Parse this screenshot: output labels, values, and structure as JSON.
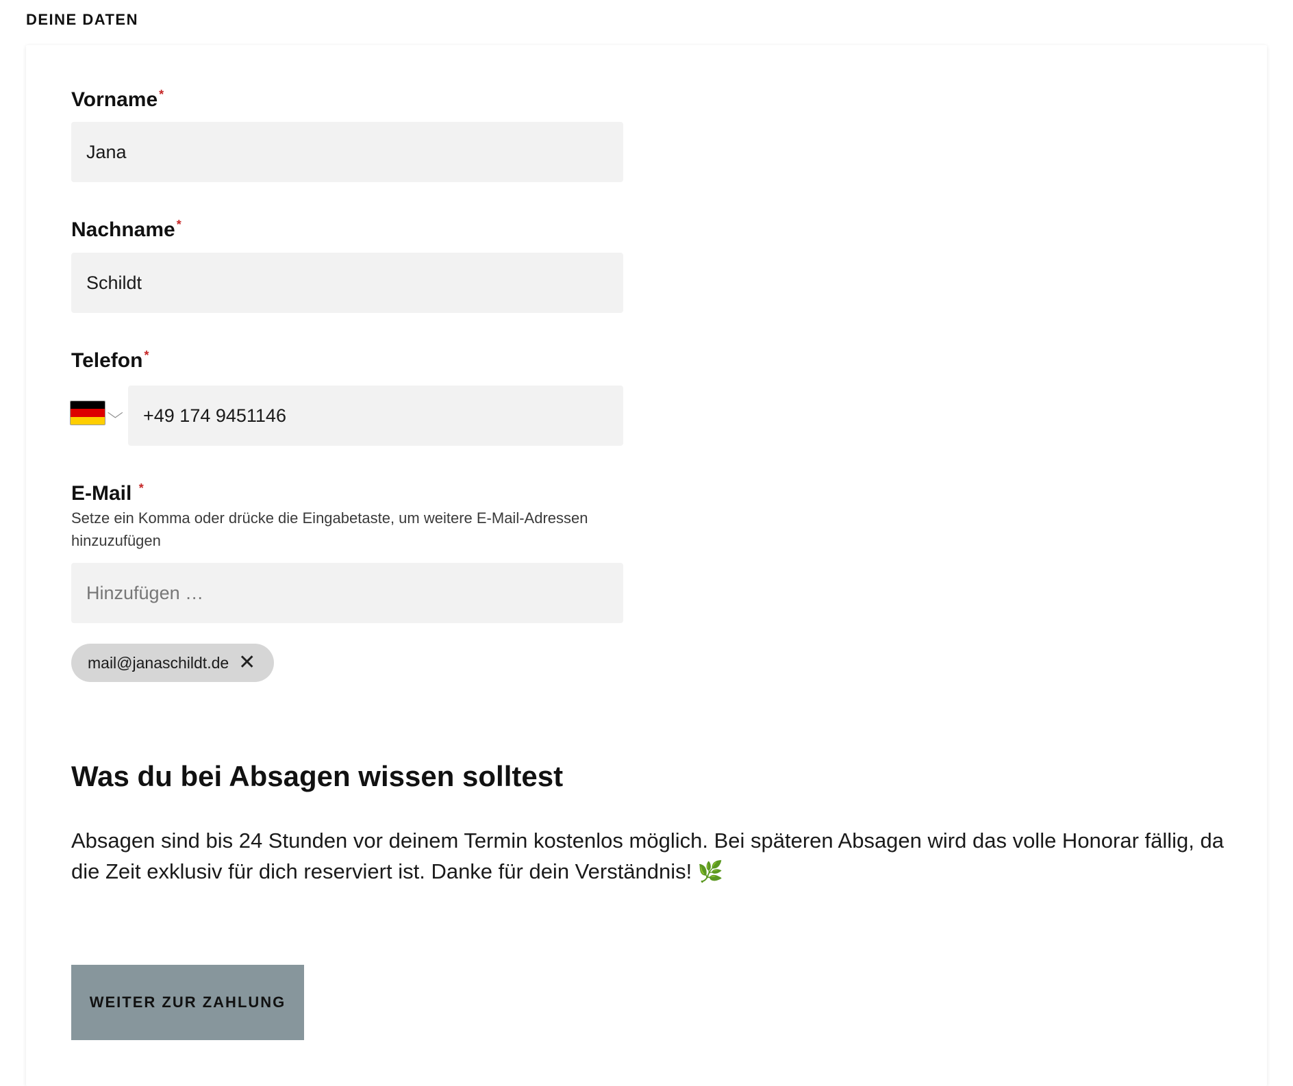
{
  "section": {
    "heading": "DEINE DATEN"
  },
  "form": {
    "first_name": {
      "label": "Vorname",
      "required_marker": "*",
      "value": "Jana"
    },
    "last_name": {
      "label": "Nachname",
      "required_marker": "*",
      "value": "Schildt"
    },
    "phone": {
      "label": "Telefon",
      "required_marker": "*",
      "country_flag": "flag-germany-icon",
      "country_dropdown_icon": "chevron-down-icon",
      "value": "+49 174 9451146",
      "flag_colors": [
        "#000000",
        "#dd0000",
        "#ffce00"
      ]
    },
    "email": {
      "label": "E-Mail",
      "required_marker": "*",
      "hint": "Setze ein Komma oder drücke die Eingabetaste, um weitere E-Mail-Adressen hinzuzufügen",
      "placeholder": "Hinzufügen …",
      "value": "",
      "chips": [
        {
          "text": "mail@janaschildt.de",
          "remove_icon": "close-icon"
        }
      ]
    }
  },
  "cancellation": {
    "title": "Was du bei Absagen wissen solltest",
    "body": "Absagen sind bis 24 Stunden vor deinem Termin kostenlos möglich. Bei späteren Absagen wird das volle Honorar fällig, da die Zeit exklusiv für dich reserviert ist. Danke für dein Verständnis!",
    "emoji": "🌿"
  },
  "actions": {
    "continue_label": "WEITER ZUR ZAHLUNG"
  },
  "colors": {
    "required": "#c62828",
    "input_bg": "#f2f2f2",
    "chip_bg": "#d6d6d6",
    "button_bg": "#87969c"
  }
}
